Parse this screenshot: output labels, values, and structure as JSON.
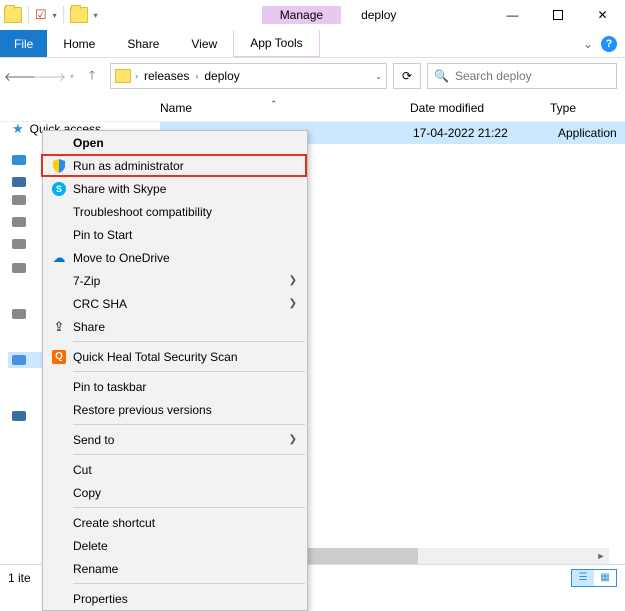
{
  "window": {
    "manage_label": "Manage",
    "title": "deploy",
    "minimize": "—",
    "close": "✕"
  },
  "ribbon": {
    "file": "File",
    "home": "Home",
    "share": "Share",
    "view": "View",
    "apptools": "App Tools",
    "help": "?",
    "expand": "⌄"
  },
  "nav": {
    "crumb1": "releases",
    "crumb2": "deploy",
    "refresh": "⟳",
    "search_placeholder": "Search deploy"
  },
  "columns": {
    "name": "Name",
    "date": "Date modified",
    "type": "Type"
  },
  "sidebar": {
    "quick_access": "Quick access"
  },
  "file": {
    "date": "17-04-2022 21:22",
    "type": "Application"
  },
  "context_menu": {
    "open": "Open",
    "run_admin": "Run as administrator",
    "skype": "Share with Skype",
    "troubleshoot": "Troubleshoot compatibility",
    "pin_start": "Pin to Start",
    "onedrive": "Move to OneDrive",
    "sevenzip": "7-Zip",
    "crcsha": "CRC SHA",
    "share": "Share",
    "quickheal": "Quick Heal Total Security Scan",
    "pin_taskbar": "Pin to taskbar",
    "restore": "Restore previous versions",
    "sendto": "Send to",
    "cut": "Cut",
    "copy": "Copy",
    "shortcut": "Create shortcut",
    "delete": "Delete",
    "rename": "Rename",
    "properties": "Properties"
  },
  "status": {
    "count": "1 ite"
  }
}
